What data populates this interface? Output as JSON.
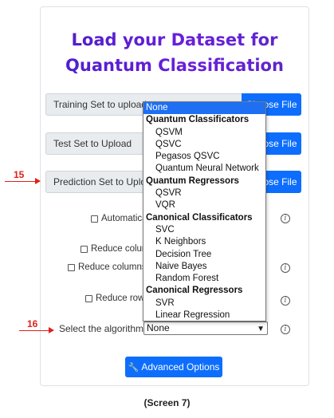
{
  "title_line1": "Load your Dataset for",
  "title_line2": "Quantum Classification",
  "uploads": [
    {
      "label": "Training Set to upload",
      "button": "Choose File"
    },
    {
      "label": "Test Set to Upload",
      "button": "Choose File"
    },
    {
      "label": "Prediction Set to Upload",
      "button": "Choose File"
    }
  ],
  "checkboxes": {
    "automatic": "Automatica",
    "reduce_columns_1": "Reduce colum",
    "reduce_columns_2": "Reduce columns",
    "reduce_rows": "Reduce rows"
  },
  "algorithm": {
    "label": "Select the algorithm:",
    "value": "None"
  },
  "advanced_button": "Advanced Options",
  "markers": {
    "m15": "15",
    "m16": "16"
  },
  "caption": "(Screen 7)",
  "dropdown": {
    "selected": "None",
    "groups": [
      {
        "name": "Quantum Classificators",
        "options": [
          "QSVM",
          "QSVC",
          "Pegasos QSVC",
          "Quantum Neural Network"
        ]
      },
      {
        "name": "Quantum Regressors",
        "options": [
          "QSVR",
          "VQR"
        ]
      },
      {
        "name": "Canonical Classificators",
        "options": [
          "SVC",
          "K Neighbors",
          "Decision Tree",
          "Naive Bayes",
          "Random Forest"
        ]
      },
      {
        "name": "Canonical Regressors",
        "options": [
          "SVR",
          "Linear Regression"
        ]
      }
    ]
  },
  "icons": {
    "info": "info-circle-icon",
    "wrench": "wrench-icon",
    "dropdown": "chevron-down-icon"
  },
  "colors": {
    "primary": "#0d6efd",
    "title_gradient_start": "#4b1fc9",
    "marker": "#e0201b",
    "selected_option": "#1e6ff2"
  }
}
